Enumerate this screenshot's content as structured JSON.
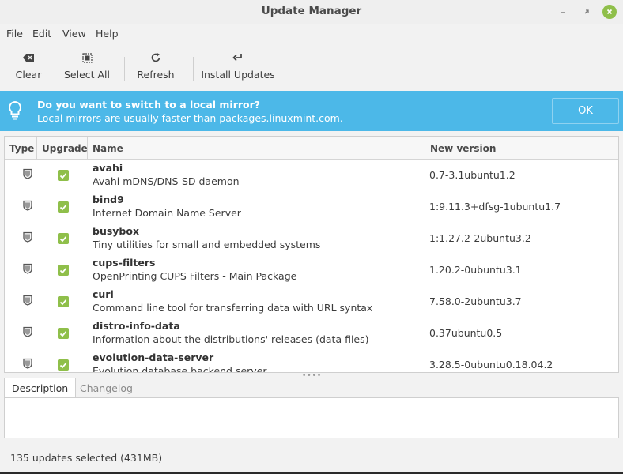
{
  "window": {
    "title": "Update Manager",
    "colors": {
      "accent": "#8fbf4a",
      "infobar": "#4cb8e8"
    }
  },
  "menu": [
    {
      "label": "File"
    },
    {
      "label": "Edit"
    },
    {
      "label": "View"
    },
    {
      "label": "Help"
    }
  ],
  "toolbar": {
    "clear_label": "Clear",
    "select_all_label": "Select All",
    "refresh_label": "Refresh",
    "install_label": "Install Updates",
    "icons": [
      "backspace-icon",
      "select-all-icon",
      "refresh-icon",
      "return-icon"
    ]
  },
  "infobar": {
    "title": "Do you want to switch to a local mirror?",
    "subtitle": "Local mirrors are usually faster than packages.linuxmint.com.",
    "ok_label": "OK",
    "icon": "lightbulb-icon"
  },
  "table": {
    "columns": [
      "Type",
      "Upgrade",
      "Name",
      "New version"
    ],
    "rows": [
      {
        "name": "avahi",
        "desc": "Avahi mDNS/DNS-SD daemon",
        "version": "0.7-3.1ubuntu1.2",
        "checked": true
      },
      {
        "name": "bind9",
        "desc": "Internet Domain Name Server",
        "version": "1:9.11.3+dfsg-1ubuntu1.7",
        "checked": true
      },
      {
        "name": "busybox",
        "desc": "Tiny utilities for small and embedded systems",
        "version": "1:1.27.2-2ubuntu3.2",
        "checked": true
      },
      {
        "name": "cups-filters",
        "desc": "OpenPrinting CUPS Filters - Main Package",
        "version": "1.20.2-0ubuntu3.1",
        "checked": true
      },
      {
        "name": "curl",
        "desc": "Command line tool for transferring data with URL syntax",
        "version": "7.58.0-2ubuntu3.7",
        "checked": true
      },
      {
        "name": "distro-info-data",
        "desc": "Information about the distributions' releases (data files)",
        "version": "0.37ubuntu0.5",
        "checked": true
      },
      {
        "name": "evolution-data-server",
        "desc": "Evolution database backend server",
        "version": "3.28.5-0ubuntu0.18.04.2",
        "checked": true
      }
    ]
  },
  "tabs": {
    "description": "Description",
    "changelog": "Changelog"
  },
  "status": {
    "text": "135 updates selected (431MB)"
  }
}
